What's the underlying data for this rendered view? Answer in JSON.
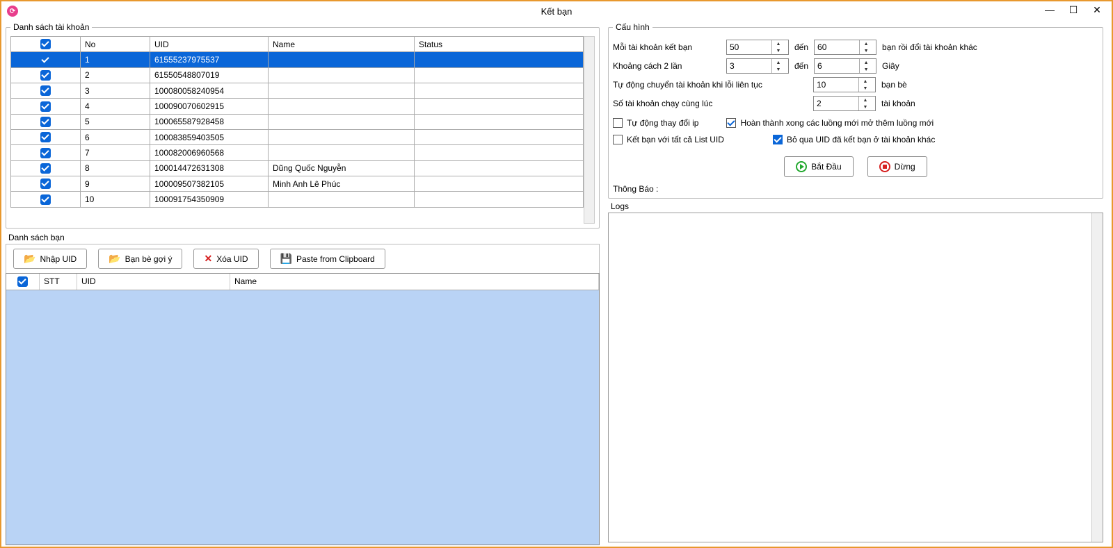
{
  "window": {
    "title": "Kết bạn"
  },
  "accounts": {
    "legend": "Danh sách tài khoản",
    "columns": {
      "no": "No",
      "uid": "UID",
      "name": "Name",
      "status": "Status"
    },
    "rows": [
      {
        "no": "1",
        "uid": "61555237975537",
        "name": "",
        "status": "",
        "selected": true
      },
      {
        "no": "2",
        "uid": "61550548807019",
        "name": "",
        "status": ""
      },
      {
        "no": "3",
        "uid": "100080058240954",
        "name": "",
        "status": ""
      },
      {
        "no": "4",
        "uid": "100090070602915",
        "name": "",
        "status": ""
      },
      {
        "no": "5",
        "uid": "100065587928458",
        "name": "",
        "status": ""
      },
      {
        "no": "6",
        "uid": "100083859403505",
        "name": "",
        "status": ""
      },
      {
        "no": "7",
        "uid": "100082006960568",
        "name": "",
        "status": ""
      },
      {
        "no": "8",
        "uid": "100014472631308",
        "name": "Dũng Quốc Nguyễn",
        "status": ""
      },
      {
        "no": "9",
        "uid": "100009507382105",
        "name": "Minh Anh Lê Phúc",
        "status": ""
      },
      {
        "no": "10",
        "uid": "100091754350909",
        "name": "",
        "status": ""
      }
    ]
  },
  "friends": {
    "title": "Danh sách bạn",
    "buttons": {
      "import": "Nhập UID",
      "suggest": "Bạn bè gợi ý",
      "delete": "Xóa UID",
      "paste": "Paste from Clipboard"
    },
    "columns": {
      "stt": "STT",
      "uid": "UID",
      "name": "Name"
    }
  },
  "config": {
    "legend": "Cấu hình",
    "row1": {
      "label": "Mỗi tài khoản kết bạn",
      "from": "50",
      "to_label": "đến",
      "to": "60",
      "suffix": "bạn rồi đổi tài khoản khác"
    },
    "row2": {
      "label": "Khoảng cách 2 lần",
      "from": "3",
      "to_label": "đến",
      "to": "6",
      "suffix": "Giây"
    },
    "row3": {
      "label": "Tự động chuyển tài khoản khi lỗi liên tục",
      "value": "10",
      "suffix": "bạn bè"
    },
    "row4": {
      "label": "Số tài khoản chạy cùng lúc",
      "value": "2",
      "suffix": "tài khoản"
    },
    "cb_autoip": "Tự động thay đổi ip",
    "cb_complete": "Hoàn thành xong các luồng mới mở thêm luồng mới",
    "cb_alllist": "Kết bạn với tất cả List UID",
    "cb_skip": "Bỏ qua UID đã kết bạn ở tài khoản khác",
    "start": "Bắt Đầu",
    "stop": "Dừng",
    "notify": "Thông Báo :"
  },
  "logs": {
    "title": "Logs"
  }
}
